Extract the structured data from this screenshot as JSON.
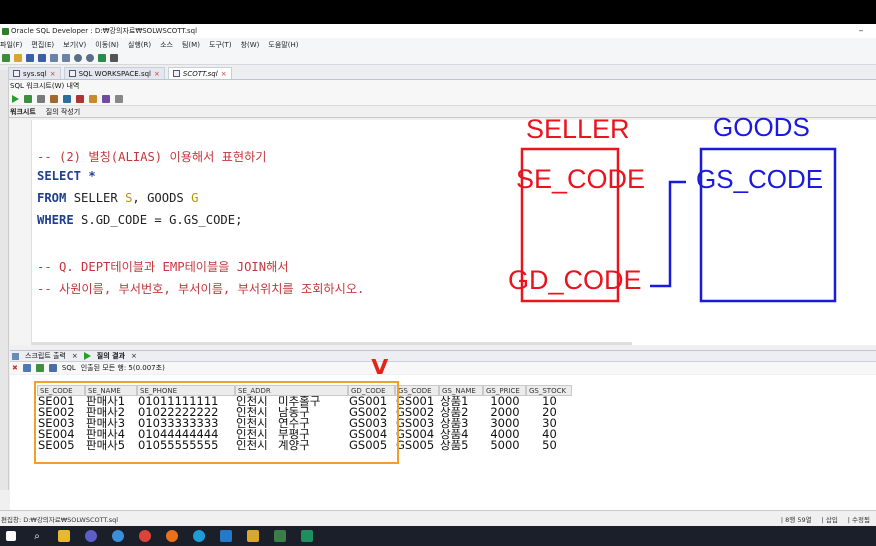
{
  "window": {
    "title": "Oracle SQL Developer : D:₩강의자료₩SOLWSCOTT.sql",
    "minimize": "–"
  },
  "menu": [
    "파일(F)",
    "편집(E)",
    "보기(V)",
    "이동(N)",
    "실행(R)",
    "소스",
    "팀(M)",
    "도구(T)",
    "창(W)",
    "도움말(H)"
  ],
  "tabs": [
    {
      "label": "sys.sql"
    },
    {
      "label": "SQL WORKSPACE.sql"
    },
    {
      "label": "SCOTT.sql"
    }
  ],
  "subbar": {
    "label": "SQL 워크시트(W) 내역"
  },
  "worksheet_tabs": [
    "워크시트",
    "질의 작성기"
  ],
  "code": {
    "line1_comment": "-- (2) 별칭(ALIAS) 이용해서 표현하기",
    "line2_select": "SELECT",
    "line2_rest": " *",
    "line3_from": "FROM",
    "line3_seller": " SELLER ",
    "line3_s": "S",
    "line3_goods": ", GOODS ",
    "line3_g": "G",
    "line4_where": "WHERE",
    "line4_rest": " S.GD_CODE = G.GS_CODE;",
    "line5_comment": "-- Q. DEPT테이블과 EMP테이블을 JOIN해서",
    "line6_comment": "-- 사원이름, 부서번호, 부서이름, 부서위치를 조회하시오."
  },
  "diagram": {
    "seller_title": "SELLER",
    "seller_field1": "SE_CODE",
    "seller_field2": "GD_CODE",
    "goods_title": "GOODS",
    "goods_field1": "GS_CODE",
    "seller_color": "#e8141e",
    "goods_color": "#1a1adc"
  },
  "results_tabs": {
    "script_output": "스크립트 출력",
    "query_result": "질의 결과"
  },
  "result_toolbar": {
    "sql_label": "SQL",
    "fetched": "인출된 모든 행: 5(0.007초)"
  },
  "grid": {
    "columns": [
      "SE_CODE",
      "SE_NAME",
      "SE_PHONE",
      "SE_ADDR",
      "GD_CODE",
      "GS_CODE",
      "GS_NAME",
      "GS_PRICE",
      "GS_STOCK"
    ],
    "rows": [
      [
        "SE001",
        "판매사1",
        "01011111111",
        "인천시",
        "미추홀구",
        "GS001",
        "GS001",
        "상품1",
        "1000",
        "10"
      ],
      [
        "SE002",
        "판매사2",
        "01022222222",
        "인천시",
        "남동구",
        "GS002",
        "GS002",
        "상품2",
        "2000",
        "20"
      ],
      [
        "SE003",
        "판매사3",
        "01033333333",
        "인천시",
        "연수구",
        "GS003",
        "GS003",
        "상품3",
        "3000",
        "30"
      ],
      [
        "SE004",
        "판매사4",
        "01044444444",
        "인천시",
        "부평구",
        "GS004",
        "GS004",
        "상품4",
        "4000",
        "40"
      ],
      [
        "SE005",
        "판매사5",
        "01055555555",
        "인천시",
        "계양구",
        "GS005",
        "GS005",
        "상품5",
        "5000",
        "50"
      ]
    ]
  },
  "annotation": {
    "check": "V",
    "box_color": "#f0a02a"
  },
  "status": {
    "path": "편집창: D:₩강의자료₩SOLWSCOTT.sql",
    "position": "| 8행 59열",
    "insert": "| 삽입",
    "modified": "| 수정됨"
  }
}
